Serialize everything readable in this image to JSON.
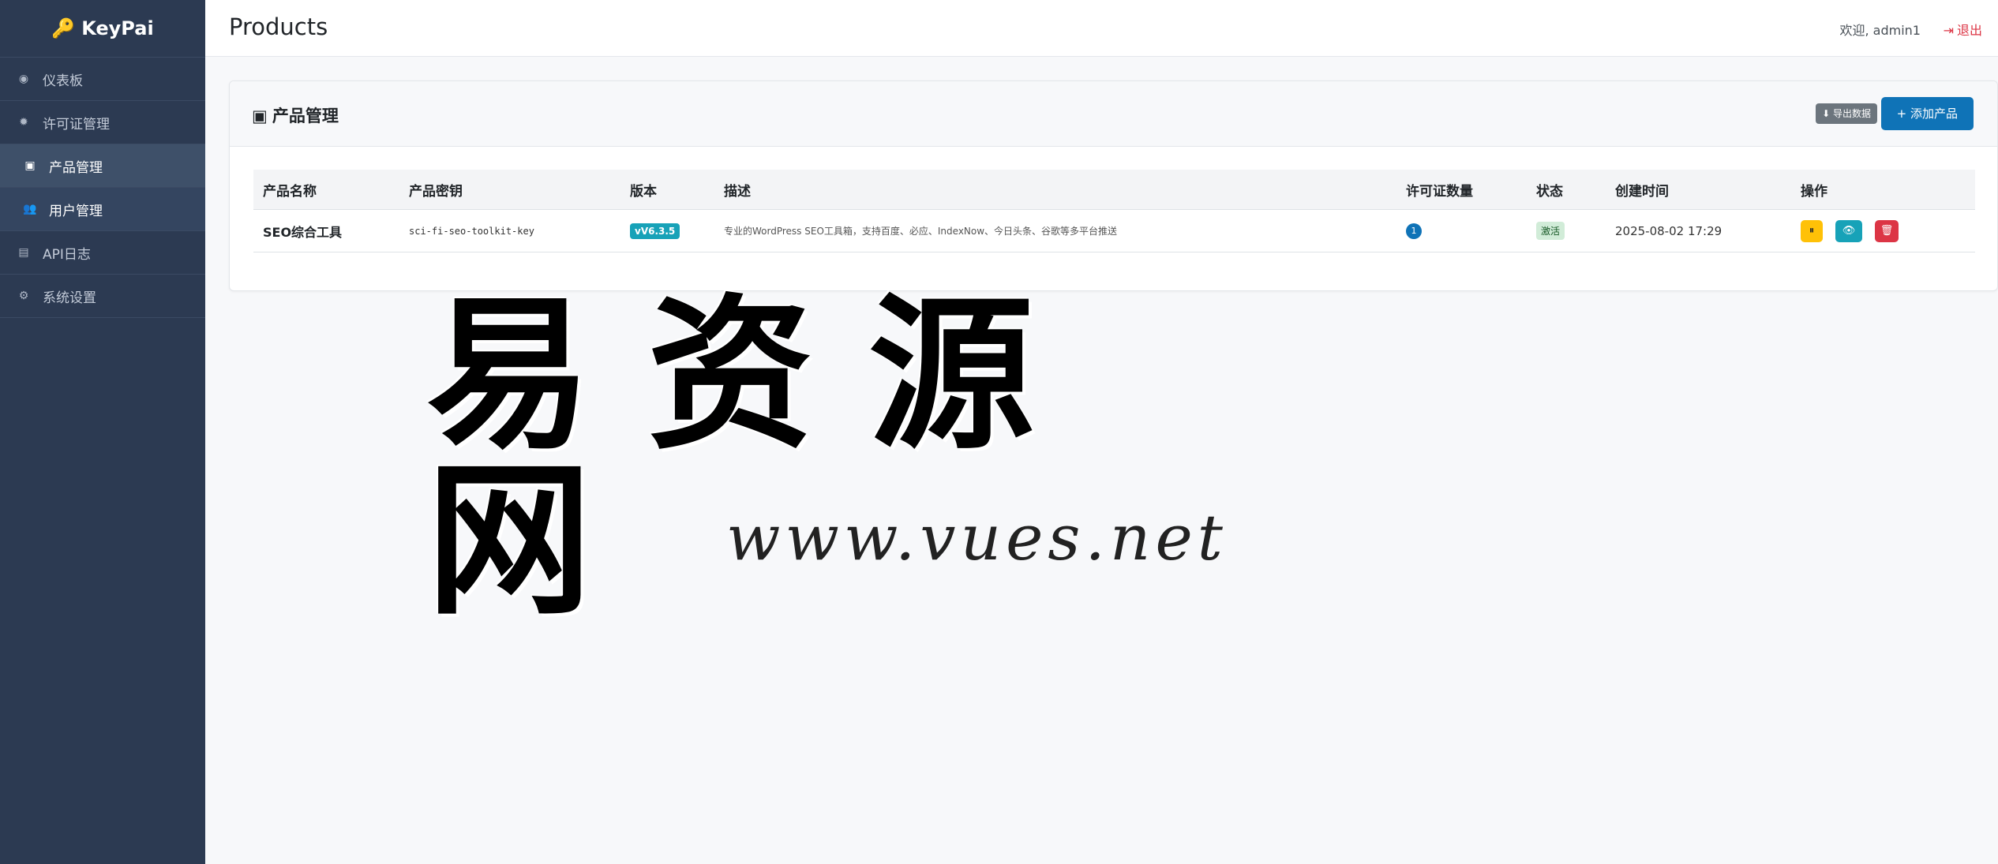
{
  "brand": {
    "name": "KeyPai",
    "icon": "key-icon"
  },
  "sidebar": {
    "items": [
      {
        "label": "仪表板",
        "icon": "dashboard-icon"
      },
      {
        "label": "许可证管理",
        "icon": "gear-icon"
      },
      {
        "label": "产品管理",
        "icon": "box-icon",
        "active": true
      },
      {
        "label": "用户管理",
        "icon": "users-icon"
      },
      {
        "label": "API日志",
        "icon": "file-icon"
      },
      {
        "label": "系统设置",
        "icon": "settings-icon"
      }
    ]
  },
  "header": {
    "title": "Products",
    "welcome": "欢迎, admin1",
    "logout": "退出"
  },
  "card": {
    "title": "产品管理",
    "export_label": "导出数据",
    "add_label": "添加产品"
  },
  "table": {
    "columns": [
      "产品名称",
      "产品密钥",
      "版本",
      "描述",
      "许可证数量",
      "状态",
      "创建时间",
      "操作"
    ],
    "rows": [
      {
        "name": "SEO综合工具",
        "key": "sci-fi-seo-toolkit-key",
        "version": "vV6.3.5",
        "description": "专业的WordPress SEO工具箱，支持百度、必应、IndexNow、今日头条、谷歌等多平台推送",
        "license_count": "1",
        "status": "激活",
        "created": "2025-08-02 17:29"
      }
    ]
  },
  "watermark": {
    "text": "易资源网",
    "url": "www.vues.net"
  },
  "colors": {
    "sidebar": "#2c3a52",
    "primary": "#0f73b7",
    "danger": "#dc3545",
    "warning": "#ffc107",
    "info": "#17a2b8"
  }
}
